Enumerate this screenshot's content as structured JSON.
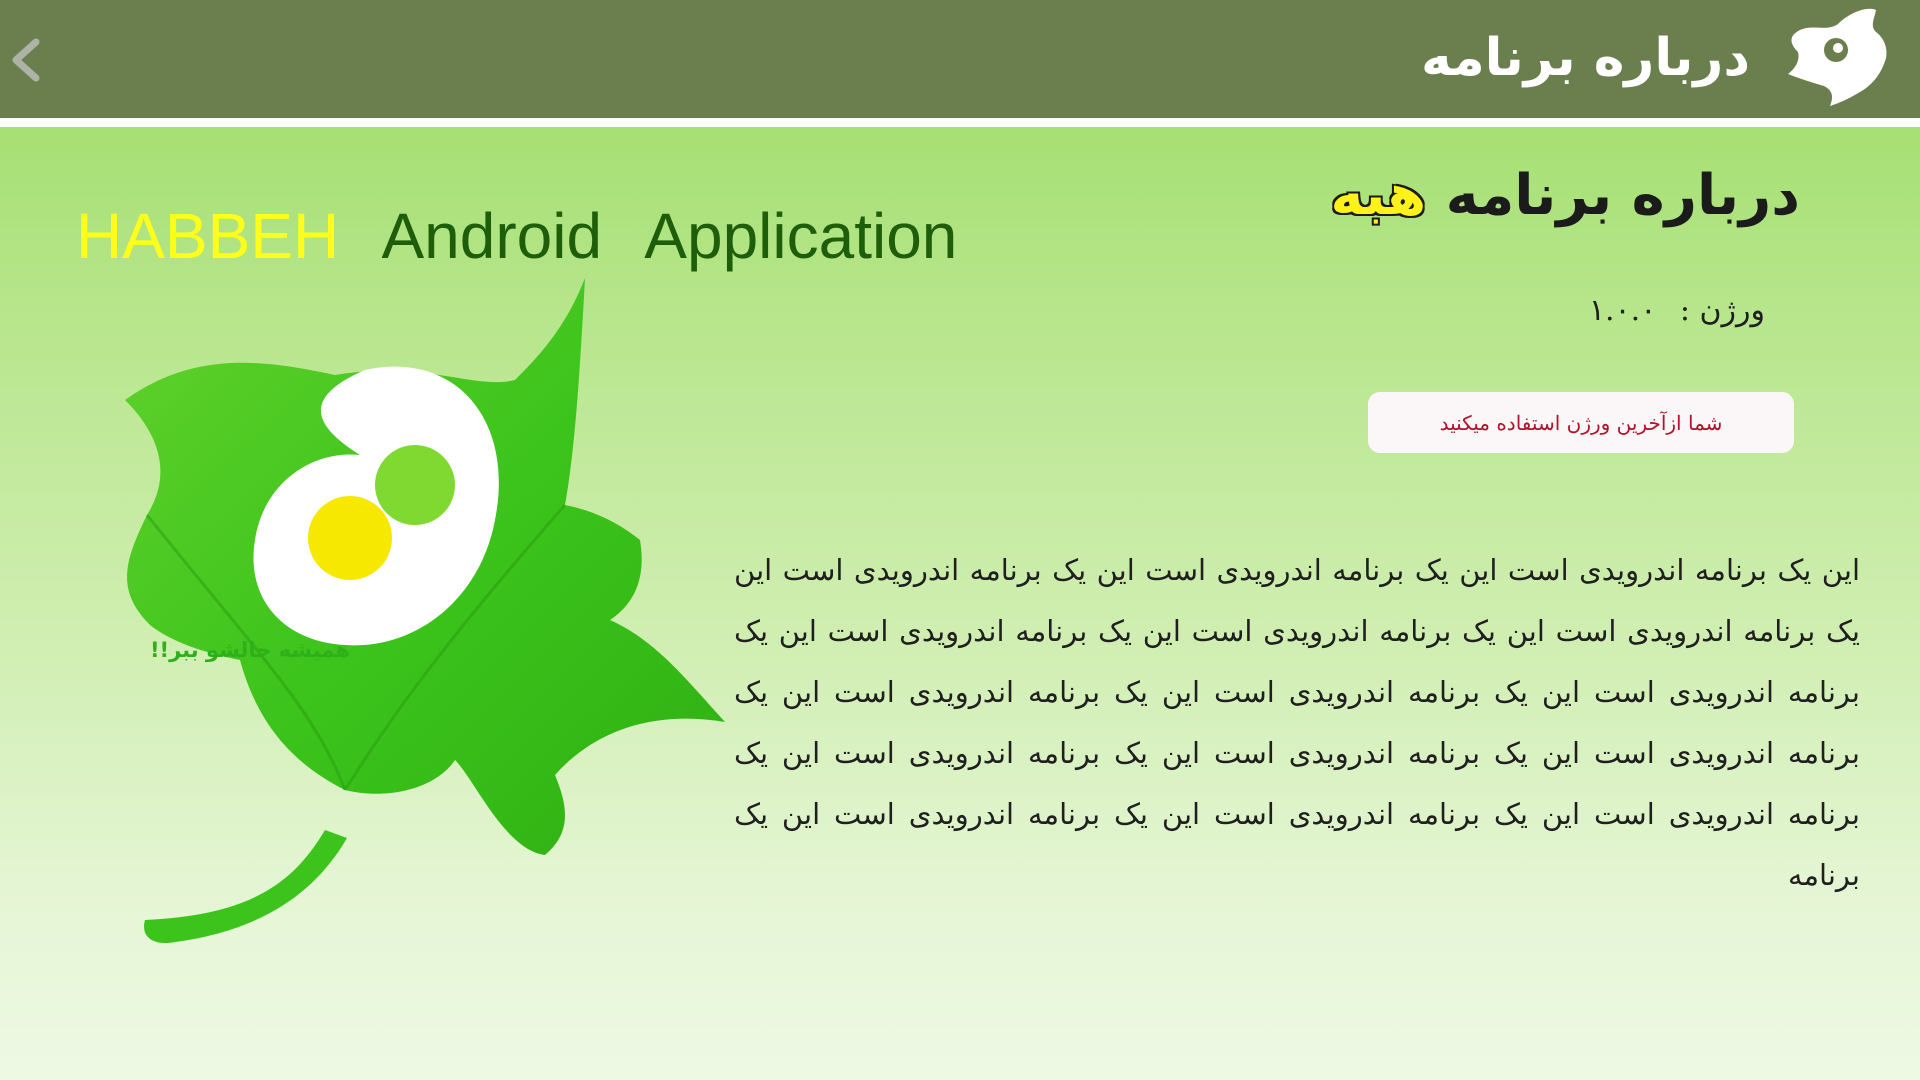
{
  "header": {
    "title": "درباره برنامه",
    "back_icon": "chevron-left-icon",
    "logo_icon": "habbeh-logo-icon",
    "background": "#6a7f4d"
  },
  "app_title": {
    "part1": "HABBEH",
    "part2": "Android",
    "part3": "Application",
    "highlight_color": "#ffff1a",
    "text_color": "#1e5e0a"
  },
  "about_heading": {
    "main": "درباره برنامه",
    "brand": "هبه"
  },
  "version": {
    "label": "ورژن :",
    "value": "۱.۰.۰"
  },
  "status": {
    "message": "شما ازآخرین ورژن استفاده میکنید",
    "color": "#b0132a"
  },
  "description": {
    "text": "این یک برنامه اندرویدی است این یک برنامه اندرویدی است این یک برنامه اندرویدی است این یک برنامه اندرویدی است این یک برنامه اندرویدی است این یک برنامه اندرویدی است این یک برنامه اندرویدی است این یک برنامه اندرویدی است این یک برنامه اندرویدی است این یک برنامه اندرویدی است این یک برنامه اندرویدی است این یک برنامه اندرویدی است این یک برنامه اندرویدی است این یک برنامه اندرویدی است این یک برنامه اندرویدی است این یک برنامه"
  },
  "logo": {
    "icon": "leaf-logo-icon",
    "tagline": "همیشه حالشو ببر!!"
  }
}
